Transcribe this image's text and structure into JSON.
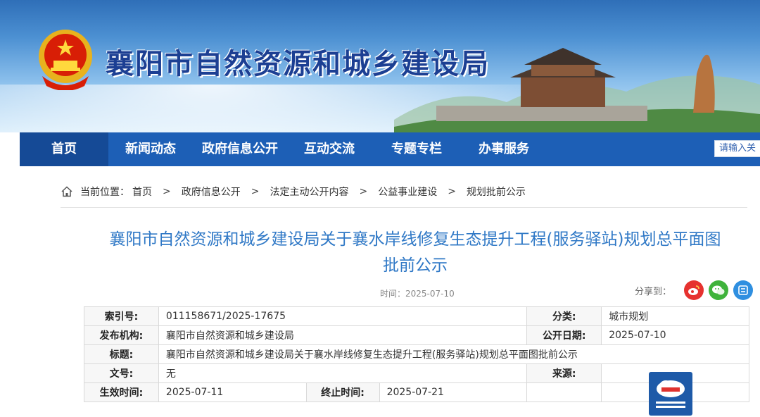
{
  "banner": {
    "title": "襄阳市自然资源和城乡建设局"
  },
  "nav": {
    "items": [
      {
        "label": "首页"
      },
      {
        "label": "新闻动态"
      },
      {
        "label": "政府信息公开"
      },
      {
        "label": "互动交流"
      },
      {
        "label": "专题专栏"
      },
      {
        "label": "办事服务"
      }
    ],
    "search_placeholder": "请输入关"
  },
  "breadcrumb": {
    "prefix": "当前位置：",
    "items": [
      "首页",
      "政府信息公开",
      "法定主动公开内容",
      "公益事业建设",
      "规划批前公示"
    ],
    "separator": ">"
  },
  "article": {
    "title_line1": "襄阳市自然资源和城乡建设局关于襄水岸线修复生态提升工程(服务驿站)规划总平面图",
    "title_line2": "批前公示",
    "time": "时间：2025-07-10",
    "share_label": "分享到："
  },
  "info": {
    "index_label": "索引号:",
    "index_value": "011158671/2025-17675",
    "category_label": "分类:",
    "category_value": "城市规划",
    "publisher_label": "发布机构:",
    "publisher_value": "襄阳市自然资源和城乡建设局",
    "pubdate_label": "公开日期:",
    "pubdate_value": "2025-07-10",
    "subject_label": "标题:",
    "subject_value": "襄阳市自然资源和城乡建设局关于襄水岸线修复生态提升工程(服务驿站)规划总平面图批前公示",
    "docno_label": "文号:",
    "docno_value": "无",
    "source_label": "来源:",
    "source_value": "",
    "effective_label": "生效时间:",
    "effective_value": "2025-07-11",
    "end_label": "终止时间:",
    "end_value": "2025-07-21"
  },
  "colors": {
    "nav": "#1d5fb6",
    "title": "#2f78c6",
    "brand": "#1c3f93"
  },
  "icons": [
    "national-emblem-icon",
    "home-icon",
    "weibo-icon",
    "wechat-icon",
    "qzone-icon"
  ]
}
